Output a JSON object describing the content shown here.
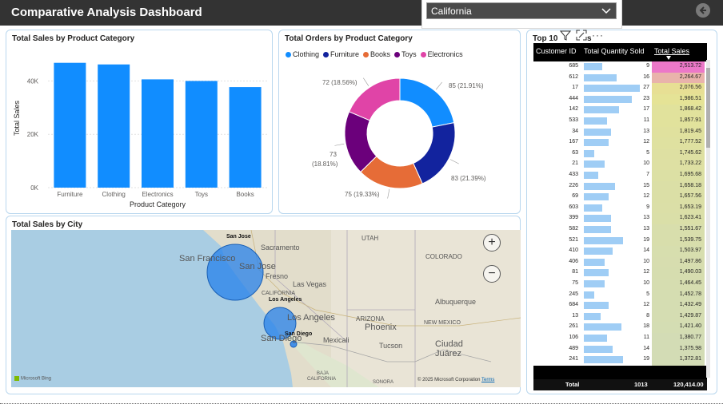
{
  "header": {
    "title": "Comparative Analysis Dashboard"
  },
  "slicer": {
    "selected": "California"
  },
  "sales_chart": {
    "title": "Total Sales by Product Category",
    "chart_data": {
      "type": "bar",
      "categories": [
        "Furniture",
        "Clothing",
        "Electronics",
        "Toys",
        "Books"
      ],
      "values": [
        46800,
        46200,
        40600,
        40000,
        37700
      ],
      "xlabel": "Product Category",
      "ylabel": "Total Sales",
      "yticks": [
        "0K",
        "20K",
        "40K"
      ],
      "ylim": [
        0,
        50000
      ],
      "color": "#118DFF"
    }
  },
  "orders_chart": {
    "title": "Total Orders by Product Category",
    "legend": [
      {
        "name": "Clothing",
        "color": "#118DFF"
      },
      {
        "name": "Furniture",
        "color": "#12239E"
      },
      {
        "name": "Books",
        "color": "#E66C37"
      },
      {
        "name": "Toys",
        "color": "#6B007B"
      },
      {
        "name": "Electronics",
        "color": "#E044A7"
      }
    ],
    "chart_data": {
      "type": "pie",
      "slices": [
        {
          "name": "Clothing",
          "value": 85,
          "label": "85 (21.91%)",
          "color": "#118DFF"
        },
        {
          "name": "Furniture",
          "value": 83,
          "label": "83 (21.39%)",
          "color": "#12239E"
        },
        {
          "name": "Books",
          "value": 75,
          "label": "75 (19.33%)",
          "color": "#E66C37"
        },
        {
          "name": "Toys",
          "value": 73,
          "label_a": "73",
          "label_b": "(18.81%)",
          "color": "#6B007B"
        },
        {
          "name": "Electronics",
          "value": 72,
          "label": "72 (18.56%)",
          "color": "#E044A7"
        }
      ]
    }
  },
  "map": {
    "title": "Total Sales by City",
    "cities": [
      "San Jose",
      "Los Angeles",
      "San Diego"
    ],
    "labels": {
      "sacramento": "Sacramento",
      "utah": "UTAH",
      "colorado": "COLORADO",
      "sanfrancisco": "San Francisco",
      "sanjose": "San Jose",
      "fresno": "Fresno",
      "lasvegas": "Las Vegas",
      "california": "CALIFORNIA",
      "albuquerque": "Albuquerque",
      "arizona": "ARIZONA",
      "newmexico": "NEW MEXICO",
      "phoenix": "Phoenix",
      "losangeles": "Los Angeles",
      "sandiego": "San Diego",
      "mexicali": "Mexicali",
      "tucson": "Tucson",
      "ciudad": "Ciudad",
      "juarez": "Juárez",
      "baja": "BAJA",
      "bajacal": "CALIFORNIA",
      "sonora": "SONORA"
    },
    "bing": "Microsoft Bing",
    "copyright": "© 2025 Microsoft Corporation",
    "terms": "Terms"
  },
  "table": {
    "title_prefix": "Top 10",
    "title_suffix": "s",
    "columns": [
      "Customer ID",
      "Total Quantity Sold",
      "Total Sales"
    ],
    "rows": [
      [
        "685",
        "9",
        "2,513.72"
      ],
      [
        "612",
        "16",
        "2,264.67"
      ],
      [
        "17",
        "27",
        "2,076.56"
      ],
      [
        "444",
        "23",
        "1,986.51"
      ],
      [
        "142",
        "17",
        "1,868.42"
      ],
      [
        "533",
        "11",
        "1,857.91"
      ],
      [
        "34",
        "13",
        "1,819.45"
      ],
      [
        "167",
        "12",
        "1,777.52"
      ],
      [
        "63",
        "5",
        "1,745.62"
      ],
      [
        "21",
        "10",
        "1,733.22"
      ],
      [
        "433",
        "7",
        "1,695.68"
      ],
      [
        "226",
        "15",
        "1,658.18"
      ],
      [
        "69",
        "12",
        "1,657.56"
      ],
      [
        "603",
        "9",
        "1,653.19"
      ],
      [
        "399",
        "13",
        "1,623.41"
      ],
      [
        "582",
        "13",
        "1,551.67"
      ],
      [
        "521",
        "19",
        "1,539.75"
      ],
      [
        "410",
        "14",
        "1,503.97"
      ],
      [
        "406",
        "10",
        "1,497.86"
      ],
      [
        "81",
        "12",
        "1,490.03"
      ],
      [
        "75",
        "10",
        "1,464.45"
      ],
      [
        "245",
        "5",
        "1,452.78"
      ],
      [
        "684",
        "12",
        "1,432.49"
      ],
      [
        "13",
        "8",
        "1,429.87"
      ],
      [
        "261",
        "18",
        "1,421.40"
      ],
      [
        "106",
        "11",
        "1,380.77"
      ],
      [
        "489",
        "14",
        "1,375.98"
      ],
      [
        "241",
        "19",
        "1,372.81"
      ]
    ],
    "total": {
      "label": "Total",
      "qty": "1013",
      "sales": "120,414.00"
    }
  }
}
